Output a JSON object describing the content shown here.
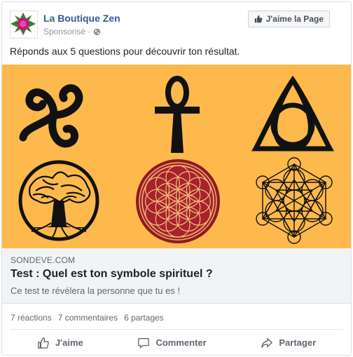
{
  "post": {
    "page_name": "La Boutique Zen",
    "sponsored": "Sponsorisé ·",
    "like_page_label": "J'aime la Page",
    "text": "Réponds aux 5 questions pour découvrir ton résultat."
  },
  "link": {
    "domain": "SONDEVE.COM",
    "title": "Test : Quel est ton symbole spirituel ?",
    "description": "Ce test te révélera la personne que tu es !"
  },
  "stats": {
    "reactions": "7 réactions",
    "comments": "7 commentaires",
    "shares": "6 partages"
  },
  "actions": {
    "like": "J'aime",
    "comment": "Commenter",
    "share": "Partager"
  },
  "colors": {
    "hero_bg": "#fdb94b",
    "link_blue": "#365899"
  },
  "icons": [
    "avatar-lotus-icon",
    "globe-icon",
    "thumbs-up-icon",
    "comment-icon",
    "share-icon"
  ]
}
